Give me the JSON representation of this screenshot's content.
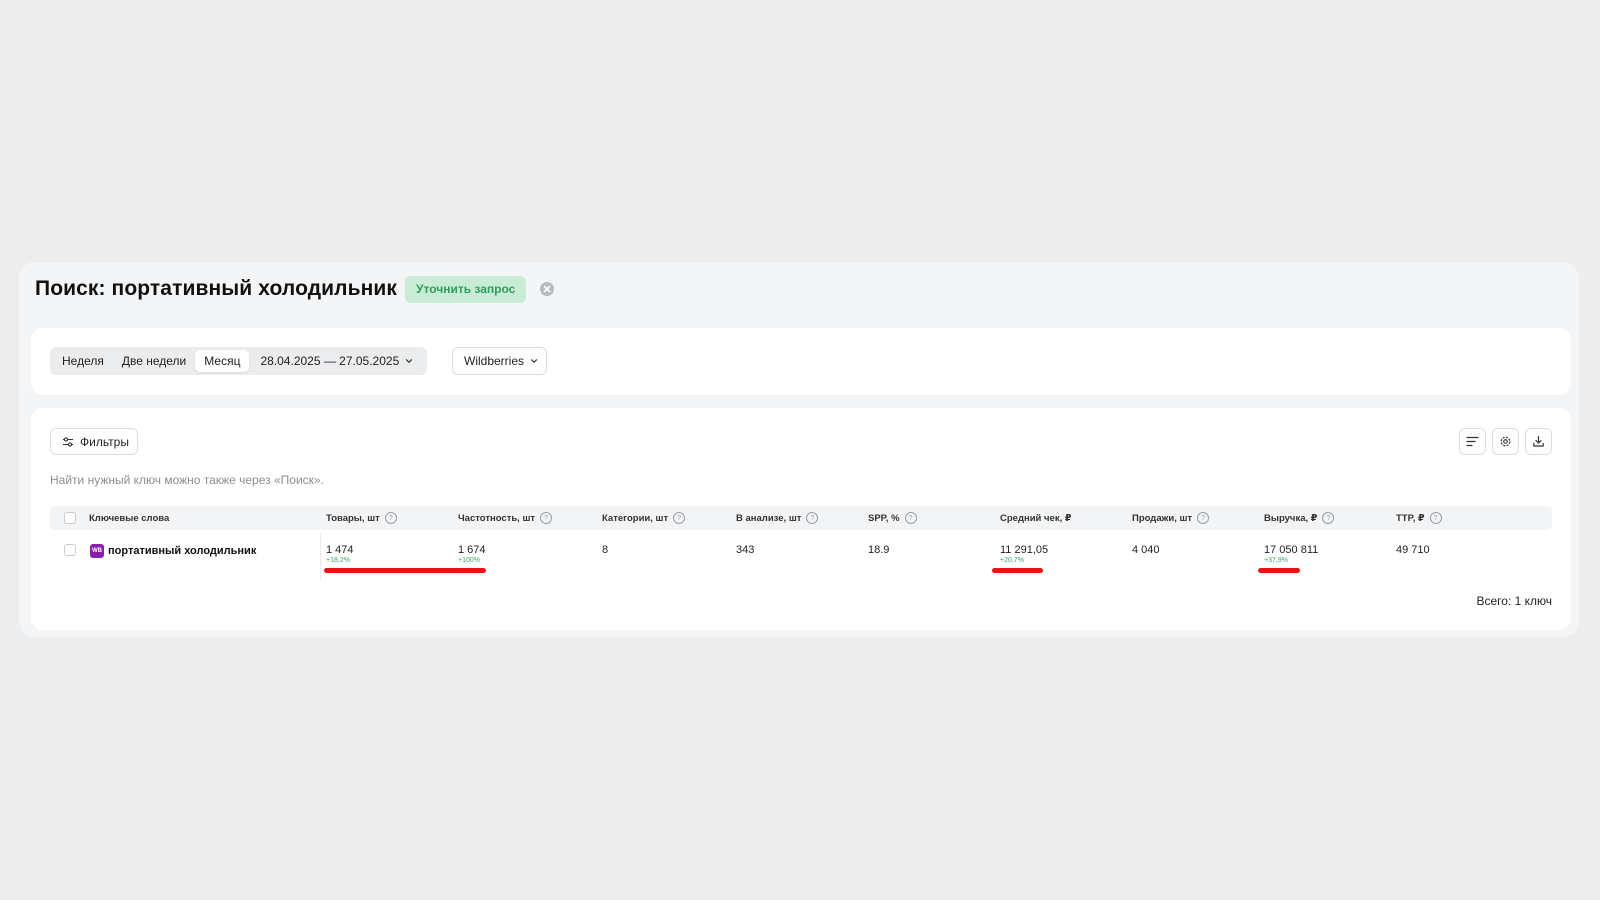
{
  "header": {
    "title": "Поиск: портативный холодильник",
    "refine_label": "Уточнить запрос"
  },
  "period": {
    "options": [
      "Неделя",
      "Две недели",
      "Месяц"
    ],
    "active": "Месяц",
    "date_range": "28.04.2025 — 27.05.2025"
  },
  "marketplace": {
    "selected": "Wildberries"
  },
  "toolbar": {
    "filters_label": "Фильтры"
  },
  "hint": "Найти нужный ключ можно также через «Поиск».",
  "table": {
    "columns": [
      "Ключевые слова",
      "Товары, шт",
      "Частотность, шт",
      "Категории, шт",
      "В анализе, шт",
      "SPP, %",
      "Средний чек, ₽",
      "Продажи, шт",
      "Выручка, ₽",
      "TTP, ₽"
    ],
    "rows": [
      {
        "badge": "WB",
        "keyword": "портативный холодильник",
        "products": "1 474",
        "products_delta": "+18,2%",
        "frequency": "1 674",
        "frequency_delta": "+100%",
        "categories": "8",
        "in_analysis": "343",
        "spp": "18.9",
        "avg_check": "11 291,05",
        "avg_check_delta": "+20,7%",
        "sales": "4 040",
        "revenue": "17 050 811",
        "revenue_delta": "+37,9%",
        "ttp": "49 710"
      }
    ]
  },
  "footer": {
    "total": "Всего: 1 ключ"
  },
  "colors": {
    "accent_green": "#2f9e5a",
    "refine_bg": "#c9ecd6",
    "delta_green": "#3aa86b",
    "wb_purple": "#8b1ea8",
    "annotation_red": "#ee1111"
  }
}
